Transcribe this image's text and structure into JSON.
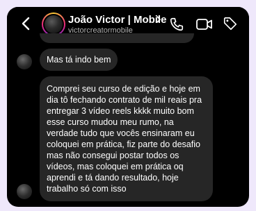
{
  "header": {
    "name": "João Victor | Mobile",
    "handle": "victorcreatormobile"
  },
  "messages": [
    {
      "text": "Mas tá indo bem"
    },
    {
      "text": "Comprei seu curso de edição e hoje em dia tô fechando contrato de mil reais pra entregar 3 vídeo reels kkkk muito bom esse curso mudou meu rumo, na verdade tudo que vocês ensinaram eu coloquei em prática, fiz parte do desafio mas não consegui postar todos os vídeos, mas coloquei em prática oq aprendi e tá dando resultado, hoje trabalho só com isso"
    }
  ],
  "icons": {
    "back": "chevron-left-icon",
    "phone": "phone-icon",
    "video": "video-camera-icon",
    "tag": "tag-icon"
  }
}
